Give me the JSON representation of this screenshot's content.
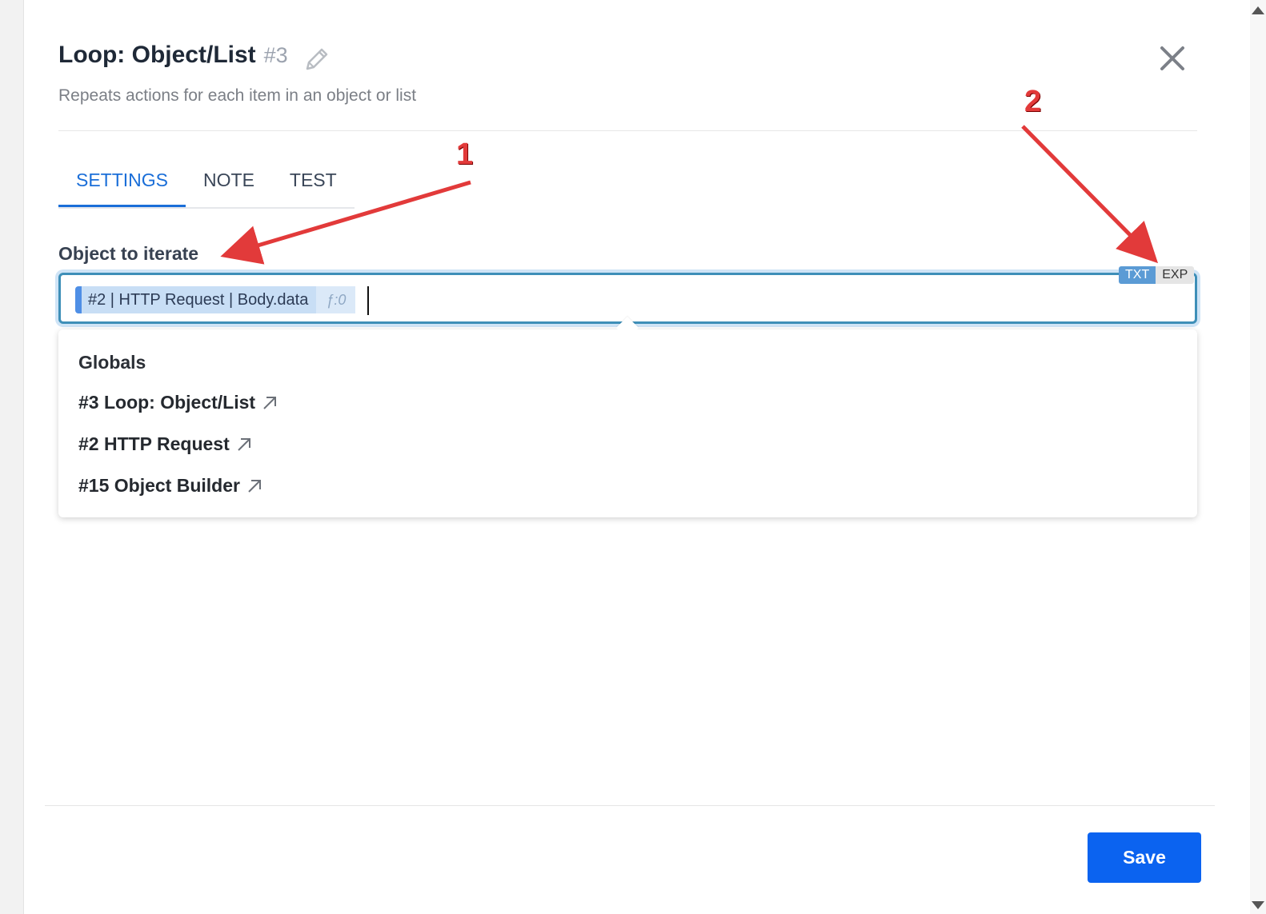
{
  "dialog": {
    "title": "Loop: Object/List",
    "title_number": "#3",
    "subtitle": "Repeats actions for each item in an object or list"
  },
  "tabs": [
    {
      "label": "SETTINGS",
      "active": true
    },
    {
      "label": "NOTE",
      "active": false
    },
    {
      "label": "TEST",
      "active": false
    }
  ],
  "field": {
    "label": "Object to iterate",
    "token_text": "#2 | HTTP Request | Body.data",
    "token_func": "ƒ:0",
    "mode_txt": "TXT",
    "mode_exp": "EXP",
    "active_mode": "TXT"
  },
  "dropdown": {
    "heading": "Globals",
    "items": [
      {
        "label": "#3 Loop: Object/List"
      },
      {
        "label": "#2 HTTP Request"
      },
      {
        "label": "#15 Object Builder"
      }
    ]
  },
  "footer": {
    "save_label": "Save"
  },
  "annotations": {
    "marker_1": "1",
    "marker_2": "2"
  },
  "colors": {
    "accent": "#1a6ed8",
    "save_button": "#0b63f0",
    "input_border": "#3e8fb8",
    "annotation": "#e23a3a"
  },
  "icons": {
    "edit": "pencil-icon",
    "close": "close-icon",
    "external": "arrow-up-right-icon"
  }
}
